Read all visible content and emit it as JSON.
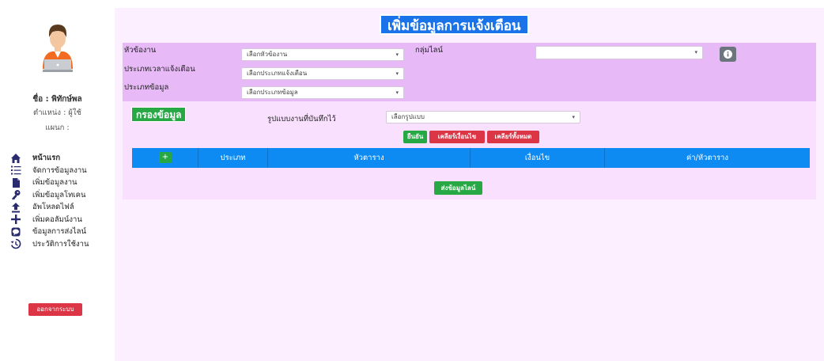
{
  "user": {
    "name": "ชื่อ : พิทักษ์พล",
    "position": "ตำแหน่ง : ผู้ใช้",
    "department": "แผนก :"
  },
  "nav": [
    {
      "label": "หน้าแรก",
      "icon": "home-icon",
      "bold": true
    },
    {
      "label": "จัดการข้อมูลงาน",
      "icon": "list-icon"
    },
    {
      "label": "เพิ่มข้อมูลงาน",
      "icon": "file-icon"
    },
    {
      "label": "เพิ่มข้อมูลโทเคน",
      "icon": "key-icon"
    },
    {
      "label": "อัพโหลดไฟล์",
      "icon": "upload-icon"
    },
    {
      "label": "เพิ่มคอลัมน์งาน",
      "icon": "plus-icon"
    },
    {
      "label": "ข้อมูลการส่งไลน์",
      "icon": "line-icon"
    },
    {
      "label": "ประวัติการใช้งาน",
      "icon": "history-icon"
    }
  ],
  "logout_label": "ออกจากระบบ",
  "page_title": "เพิ่มข้อมูลการแจ้งเตือน",
  "form": {
    "topic_label": "หัวข้องาน",
    "topic_value": "เลือกหัวข้องาน",
    "line_group_label": "กลุ่มไลน์",
    "line_group_value": "",
    "alert_time_label": "ประเภทเวลาแจ้งเตือน",
    "alert_time_value": "เลือกประเภทแจ้งเตือน",
    "data_type_label": "ประเภทข้อมูล",
    "data_type_value": "เลือกประเภทข้อมูล"
  },
  "filter": {
    "title": "กรองข้อมูล",
    "format_label": "รูปแบบงานที่บันทึกไว้",
    "format_value": "เลือกรูปแบบ",
    "confirm_label": "ยืนยัน",
    "clear_cond_label": "เคลียร์เงื่อนไข",
    "clear_all_label": "เคลียร์ทั้งหมด"
  },
  "table": {
    "add_label": "+",
    "columns": [
      "ประเภท",
      "หัวตาราง",
      "เงื่อนไข",
      "ค่า/หัวตาราง"
    ]
  },
  "send_label": "ส่งข้อมูลไลน์",
  "colors": {
    "panel": "#fcefff",
    "form_bg": "#e7b9f7",
    "title_bg": "#1a73e8",
    "table_head": "#0d8bf2",
    "green": "#28a745",
    "red": "#dc3545",
    "nav_icon": "#2a2a6e"
  }
}
